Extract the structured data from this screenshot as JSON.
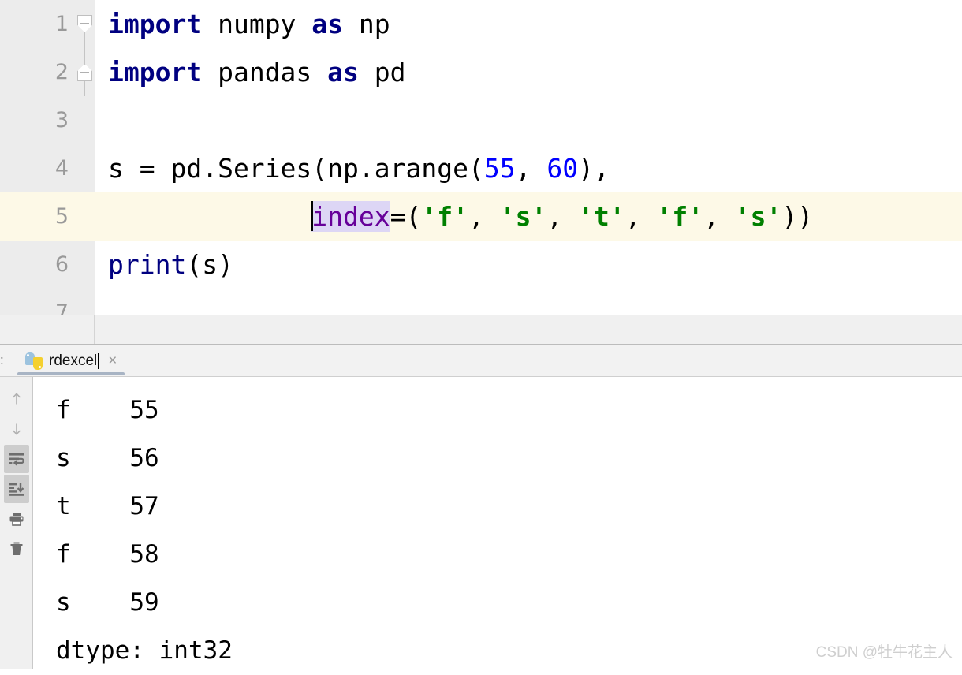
{
  "editor": {
    "lines": [
      {
        "number": "1",
        "fold": "down",
        "tokens": [
          {
            "t": "import",
            "c": "kw"
          },
          {
            "t": " numpy ",
            "c": "plain"
          },
          {
            "t": "as",
            "c": "kw"
          },
          {
            "t": " np",
            "c": "plain"
          }
        ],
        "current": false
      },
      {
        "number": "2",
        "fold": "up",
        "tokens": [
          {
            "t": "import",
            "c": "kw"
          },
          {
            "t": " pandas ",
            "c": "plain"
          },
          {
            "t": "as",
            "c": "kw"
          },
          {
            "t": " pd",
            "c": "plain"
          }
        ],
        "current": false
      },
      {
        "number": "3",
        "fold": "none",
        "tokens": [],
        "current": false
      },
      {
        "number": "4",
        "fold": "none",
        "tokens": [
          {
            "t": "s = pd.Series(np.arange(",
            "c": "plain"
          },
          {
            "t": "55",
            "c": "num"
          },
          {
            "t": ", ",
            "c": "plain"
          },
          {
            "t": "60",
            "c": "num"
          },
          {
            "t": "),",
            "c": "plain"
          }
        ],
        "current": false
      },
      {
        "number": "5",
        "fold": "none",
        "caret_before_index": 1,
        "tokens": [
          {
            "t": "             ",
            "c": "plain"
          },
          {
            "t": "index",
            "c": "kwarg sel"
          },
          {
            "t": "=(",
            "c": "plain"
          },
          {
            "t": "'f'",
            "c": "str"
          },
          {
            "t": ", ",
            "c": "plain"
          },
          {
            "t": "'s'",
            "c": "str"
          },
          {
            "t": ", ",
            "c": "plain"
          },
          {
            "t": "'t'",
            "c": "str"
          },
          {
            "t": ", ",
            "c": "plain"
          },
          {
            "t": "'f'",
            "c": "str"
          },
          {
            "t": ", ",
            "c": "plain"
          },
          {
            "t": "'s'",
            "c": "str"
          },
          {
            "t": "))",
            "c": "plain"
          }
        ],
        "current": true
      },
      {
        "number": "6",
        "fold": "none",
        "tokens": [
          {
            "t": "print",
            "c": "fnname"
          },
          {
            "t": "(s)",
            "c": "plain"
          }
        ],
        "current": false
      },
      {
        "number": "7",
        "fold": "none",
        "tokens": [],
        "current": false
      }
    ],
    "full_code": "import numpy as np\nimport pandas as pd\n\ns = pd.Series(np.arange(55, 60),\n             index=('f', 's', 't', 'f', 's'))\nprint(s)\n"
  },
  "console": {
    "tool_window_label": ":",
    "tab": {
      "label": "rdexcel",
      "icon": "python-file-icon",
      "close_label": "×"
    },
    "toolbar": [
      {
        "name": "scroll-up-button",
        "icon": "arrow-up-icon",
        "active": false
      },
      {
        "name": "scroll-down-button",
        "icon": "arrow-down-icon",
        "active": false
      },
      {
        "name": "soft-wrap-button",
        "icon": "soft-wrap-icon",
        "active": true
      },
      {
        "name": "scroll-to-end-button",
        "icon": "scroll-to-end-icon",
        "active": true
      },
      {
        "name": "print-button",
        "icon": "printer-icon",
        "active": false
      },
      {
        "name": "clear-all-button",
        "icon": "trash-icon",
        "active": false
      }
    ],
    "output_lines": [
      "f    55",
      "s    56",
      "t    57",
      "f    58",
      "s    59",
      "dtype: int32"
    ],
    "output_text": "f    55\ns    56\nt    57\nf    58\ns    59\ndtype: int32"
  },
  "watermark": {
    "text": "CSDN @牡牛花主人"
  },
  "colors": {
    "keyword": "#000080",
    "number": "#0000ff",
    "string": "#008000",
    "kwarg": "#660099",
    "selection": "#ddd6f5",
    "current_line": "#fdf9e7",
    "gutter": "#ececec",
    "tab_underline": "#a8b4c4"
  }
}
